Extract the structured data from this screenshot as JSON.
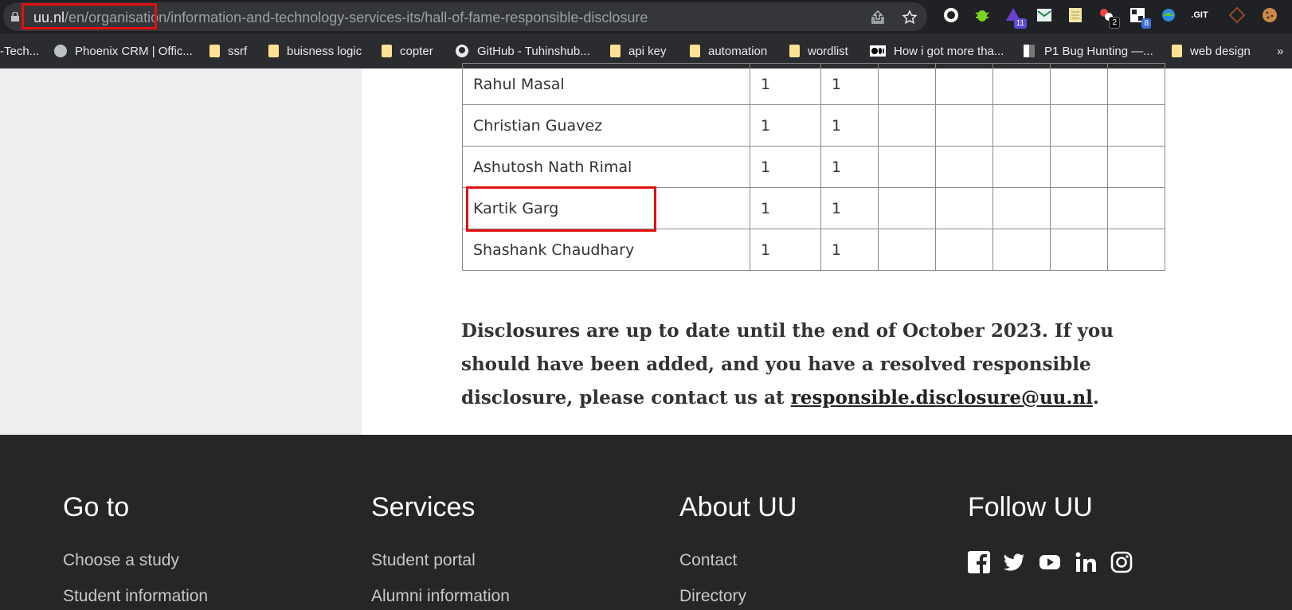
{
  "browser": {
    "url_host": "uu.nl",
    "url_path": "/en/organisation/information-and-technology-services-its/hall-of-fame-responsible-disclosure",
    "extensions": [
      {
        "icon": "extension-c-icon"
      },
      {
        "icon": "bug-icon"
      },
      {
        "icon": "wizard-hat-icon",
        "badge": "11"
      },
      {
        "icon": "envelope-icon"
      },
      {
        "icon": "notepad-icon"
      },
      {
        "icon": "cookie-red-icon",
        "badge": "2"
      },
      {
        "icon": "qr-icon",
        "badge": "8"
      },
      {
        "icon": "globe-colored-icon"
      },
      {
        "icon": "git-icon",
        "label": ".GIT"
      },
      {
        "icon": "diamond-icon"
      },
      {
        "icon": "cookie-icon"
      }
    ]
  },
  "bookmarks": [
    {
      "label": "-Tech...",
      "icon": "none"
    },
    {
      "label": "Phoenix CRM | Offic...",
      "icon": "globe-icon"
    },
    {
      "label": "ssrf",
      "icon": "folder-icon"
    },
    {
      "label": "buisness logic",
      "icon": "folder-icon"
    },
    {
      "label": "copter",
      "icon": "folder-icon"
    },
    {
      "label": "GitHub - Tuhinshub...",
      "icon": "github-icon"
    },
    {
      "label": "api key",
      "icon": "folder-icon"
    },
    {
      "label": "automation",
      "icon": "folder-icon"
    },
    {
      "label": "wordlist",
      "icon": "folder-icon"
    },
    {
      "label": "How i got more tha...",
      "icon": "medium-icon"
    },
    {
      "label": "P1 Bug Hunting —...",
      "icon": "page-icon"
    },
    {
      "label": "web design",
      "icon": "folder-icon"
    },
    {
      "label": "»",
      "icon": "none"
    }
  ],
  "table": {
    "rows": [
      {
        "name": "Rahul Masal",
        "c1": "1",
        "c2": "1"
      },
      {
        "name": "Christian Guavez",
        "c1": "1",
        "c2": "1"
      },
      {
        "name": "Ashutosh Nath Rimal",
        "c1": "1",
        "c2": "1"
      },
      {
        "name": "Kartik Garg",
        "c1": "1",
        "c2": "1"
      },
      {
        "name": "Shashank Chaudhary",
        "c1": "1",
        "c2": "1"
      }
    ]
  },
  "disclosure": {
    "text": "Disclosures are up to date until the end of October 2023. If you should have been added, and you have a resolved responsible disclosure, please contact us at ",
    "email": "responsible.disclosure@uu.nl",
    "end": "."
  },
  "footer": {
    "goto": {
      "title": "Go to",
      "links": [
        "Choose a study",
        "Student information"
      ]
    },
    "services": {
      "title": "Services",
      "links": [
        "Student portal",
        "Alumni information"
      ]
    },
    "about": {
      "title": "About UU",
      "links": [
        "Contact",
        "Directory"
      ]
    },
    "follow": {
      "title": "Follow UU",
      "social": [
        "facebook-icon",
        "twitter-icon",
        "youtube-icon",
        "linkedin-icon",
        "instagram-icon"
      ]
    }
  }
}
